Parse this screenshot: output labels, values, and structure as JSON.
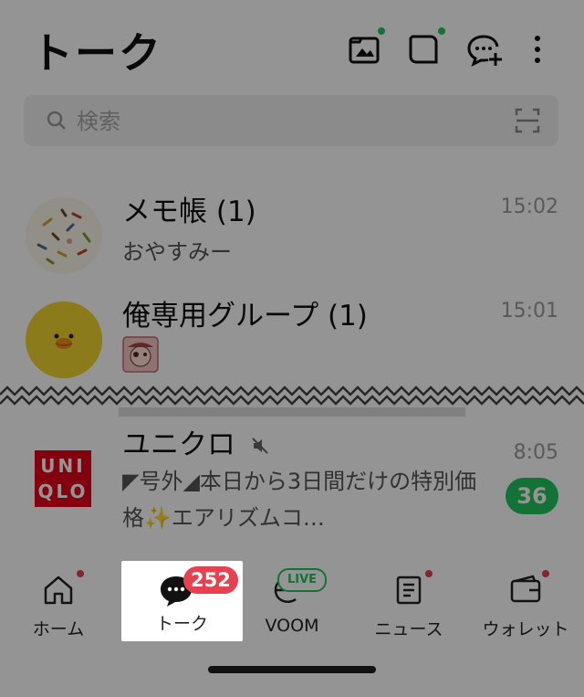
{
  "header": {
    "title": "トーク"
  },
  "search": {
    "placeholder": "検索"
  },
  "chats": [
    {
      "name": "メモ帳 (1)",
      "time": "15:02",
      "preview": "おやすみー"
    },
    {
      "name": "俺専用グループ (1)",
      "time": "15:01"
    },
    {
      "name": "ユニクロ",
      "time": "8:05",
      "preview": "◤号外◢本日から3日間だけの特別価格✨エアリズムコ…",
      "unread": "36",
      "logo": [
        "UNI",
        "QLO"
      ]
    }
  ],
  "nav": {
    "items": [
      {
        "label": "ホーム"
      },
      {
        "label": "トーク",
        "badge": "252"
      },
      {
        "label": "VOOM",
        "badge": "LIVE"
      },
      {
        "label": "ニュース"
      },
      {
        "label": "ウォレット"
      }
    ]
  },
  "colors": {
    "accent_green": "#22c55e",
    "badge_red": "#e5414f",
    "uniqlo_red": "#e3001b"
  }
}
